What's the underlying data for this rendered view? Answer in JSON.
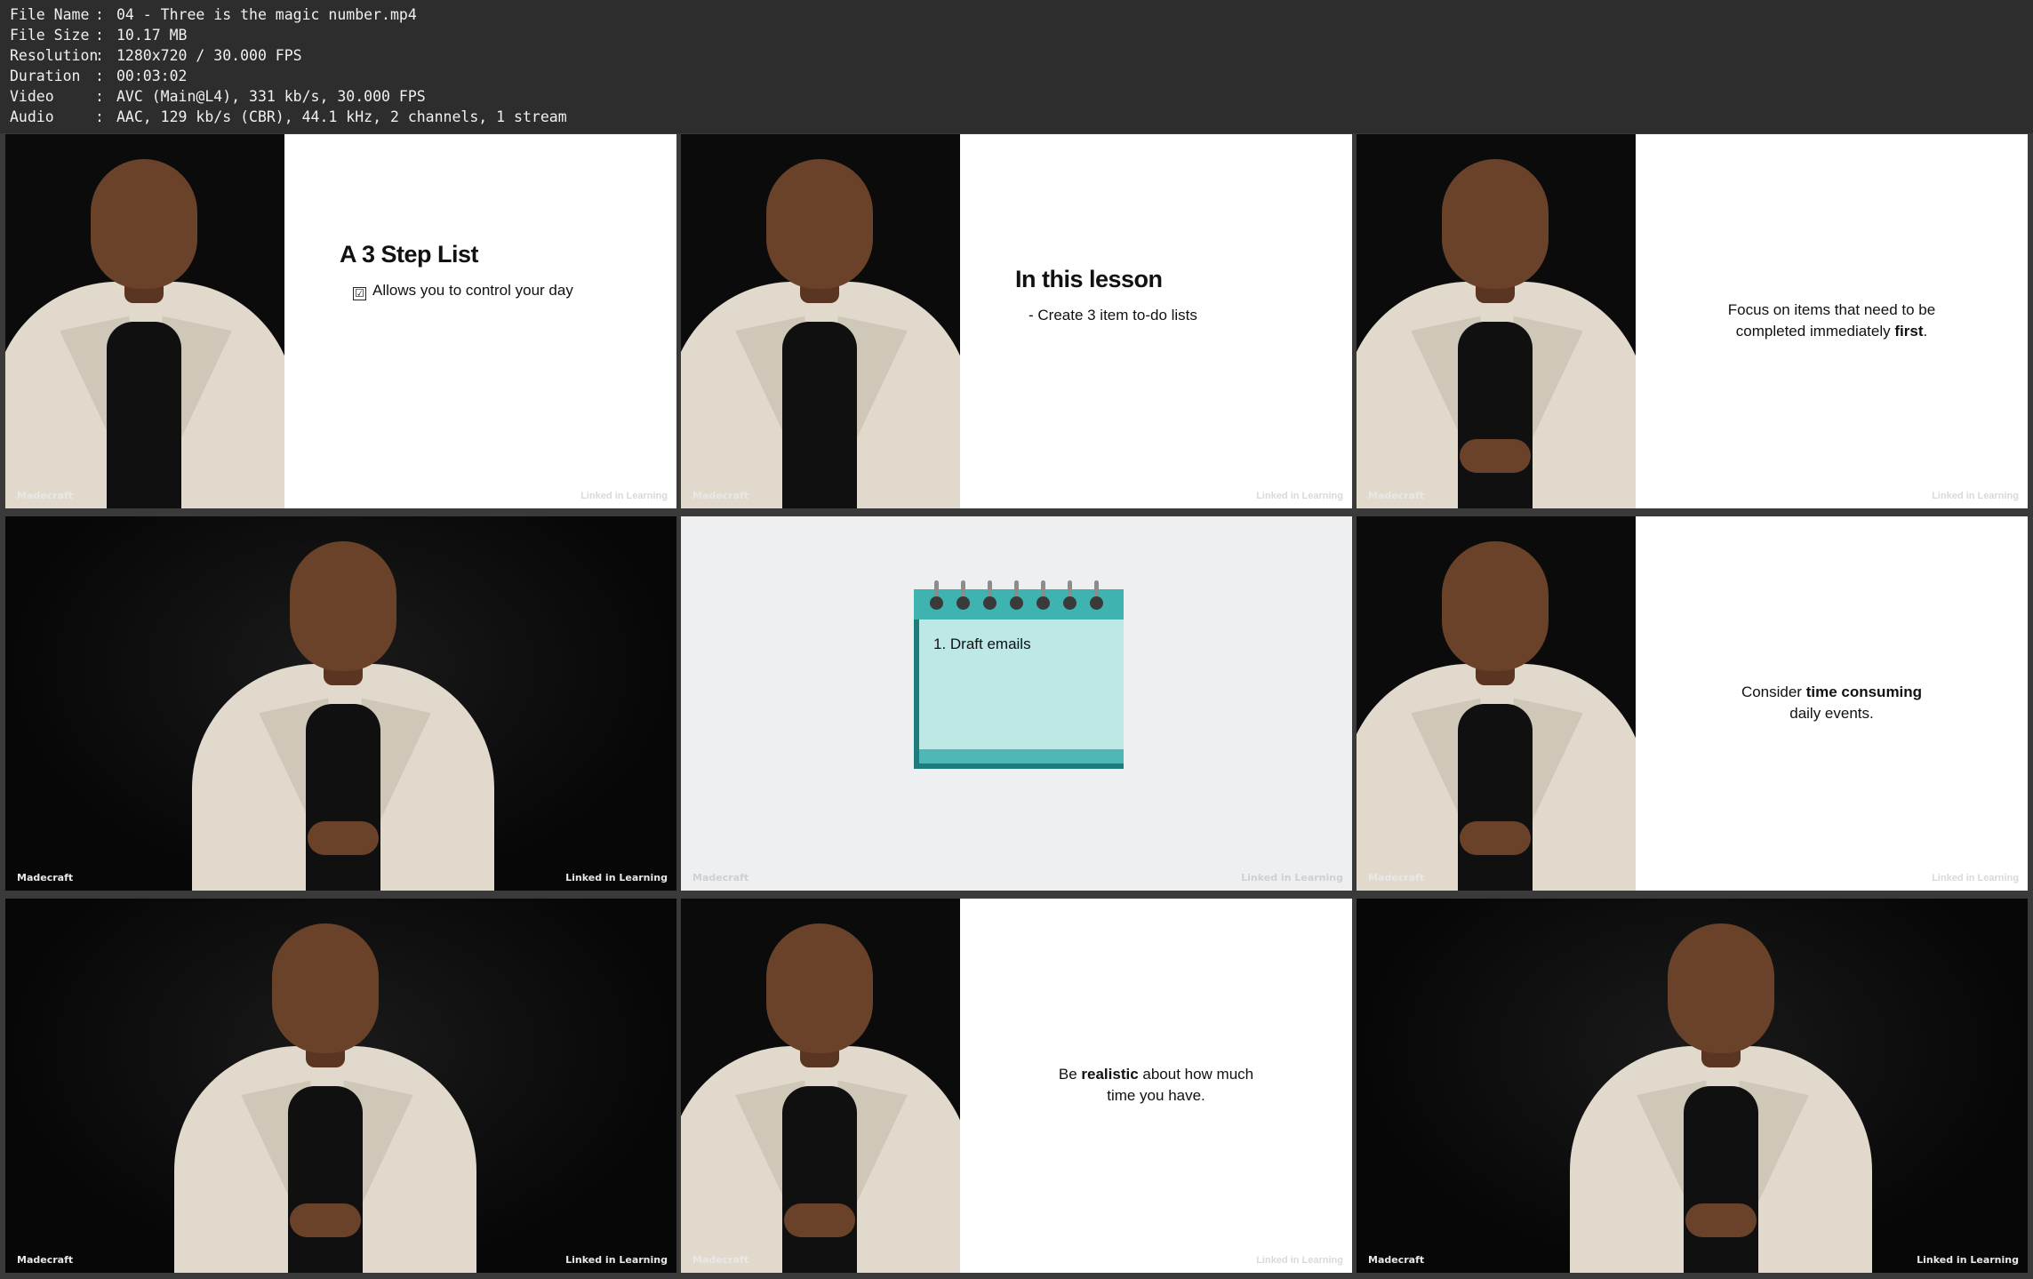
{
  "metadata": [
    {
      "key": "File Name",
      "value": "04 - Three is the magic number.mp4"
    },
    {
      "key": "File Size",
      "value": "10.17 MB"
    },
    {
      "key": "Resolution",
      "value": "1280x720 / 30.000 FPS"
    },
    {
      "key": "Duration",
      "value": "00:03:02"
    },
    {
      "key": "Video",
      "value": "AVC (Main@L4), 331 kb/s, 30.000 FPS"
    },
    {
      "key": "Audio",
      "value": "AAC, 129 kb/s (CBR), 44.1 kHz, 2 channels, 1 stream"
    }
  ],
  "watermark": {
    "left": "Madecraft",
    "right": "Linked in Learning"
  },
  "frames": {
    "f1": {
      "title": "A 3 Step List",
      "check_mark": "☑",
      "line": "Allows you to control your day"
    },
    "f2": {
      "title": "In this lesson",
      "line": "- Create 3 item to-do lists"
    },
    "f3": {
      "line1": "Focus on items that need to be",
      "line2_plain": "completed immediately ",
      "line2_bold": "first",
      "line2_end": "."
    },
    "f5": {
      "note": "1. Draft emails"
    },
    "f6": {
      "line1_plain": "Consider ",
      "line1_bold": "time consuming",
      "line2": "daily events."
    },
    "f8": {
      "line1_plain": "Be ",
      "line1_bold": "realistic",
      "line1_end": " about how much",
      "line2": "time you have."
    }
  }
}
